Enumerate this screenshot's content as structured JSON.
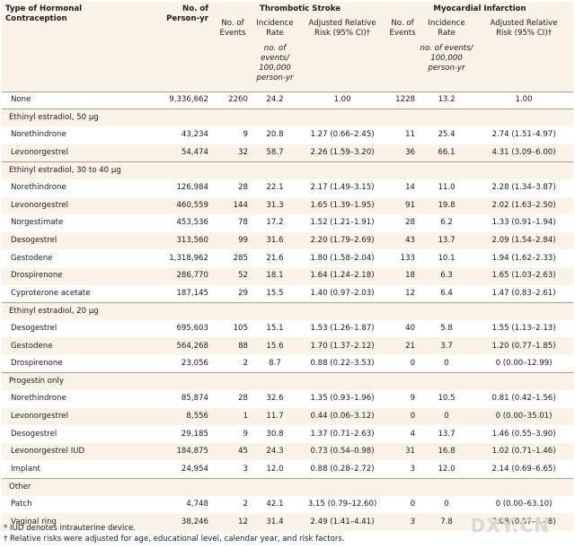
{
  "headers": {
    "type": "Type of Hormonal Contraception",
    "person_yr_1": "No. of",
    "person_yr_2": "Person-yr",
    "stroke": "Thrombotic Stroke",
    "mi": "Myocardial Infarction",
    "events_1": "No. of",
    "events_2": "Events",
    "rate_1": "Incidence",
    "rate_2": "Rate",
    "rr_1": "Adjusted Relative",
    "rr_2": "Risk (95% CI)†",
    "rate_unit_1": "no. of events/",
    "rate_unit_2": "100,000",
    "rate_unit_3": "person-yr"
  },
  "rows": [
    {
      "kind": "data",
      "label": "None",
      "indent": false,
      "py": "9,336,662",
      "s_ev": "2260",
      "s_rate": "24.2",
      "s_rr": "1.00",
      "m_ev": "1228",
      "m_rate": "13.2",
      "m_rr": "1.00"
    },
    {
      "kind": "group",
      "label": "Ethinyl estradiol, 50 μg"
    },
    {
      "kind": "data",
      "label": "Norethindrone",
      "indent": true,
      "py": "43,234",
      "s_ev": "9",
      "s_rate": "20.8",
      "s_rr": "1.27 (0.66–2.45)",
      "m_ev": "11",
      "m_rate": "25.4",
      "m_rr": "2.74 (1.51–4.97)"
    },
    {
      "kind": "data",
      "label": "Levonorgestrel",
      "indent": true,
      "py": "54,474",
      "s_ev": "32",
      "s_rate": "58.7",
      "s_rr": "2.26 (1.59–3.20)",
      "m_ev": "36",
      "m_rate": "66.1",
      "m_rr": "4.31 (3.09–6.00)"
    },
    {
      "kind": "group",
      "label": "Ethinyl estradiol, 30 to 40 μg"
    },
    {
      "kind": "data",
      "label": "Norethindrone",
      "indent": true,
      "py": "126,984",
      "s_ev": "28",
      "s_rate": "22.1",
      "s_rr": "2.17 (1.49–3.15)",
      "m_ev": "14",
      "m_rate": "11.0",
      "m_rr": "2.28 (1.34–3.87)"
    },
    {
      "kind": "data",
      "label": "Levonorgestrel",
      "indent": true,
      "py": "460,559",
      "s_ev": "144",
      "s_rate": "31.3",
      "s_rr": "1.65 (1.39–1.95)",
      "m_ev": "91",
      "m_rate": "19.8",
      "m_rr": "2.02 (1.63–2.50)"
    },
    {
      "kind": "data",
      "label": "Norgestimate",
      "indent": true,
      "py": "453,536",
      "s_ev": "78",
      "s_rate": "17.2",
      "s_rr": "1.52 (1.21–1.91)",
      "m_ev": "28",
      "m_rate": "6.2",
      "m_rr": "1.33 (0.91–1.94)"
    },
    {
      "kind": "data",
      "label": "Desogestrel",
      "indent": true,
      "py": "313,560",
      "s_ev": "99",
      "s_rate": "31.6",
      "s_rr": "2.20 (1.79–2.69)",
      "m_ev": "43",
      "m_rate": "13.7",
      "m_rr": "2.09 (1.54–2.84)"
    },
    {
      "kind": "data",
      "label": "Gestodene",
      "indent": true,
      "py": "1,318,962",
      "s_ev": "285",
      "s_rate": "21.6",
      "s_rr": "1.80 (1.58–2.04)",
      "m_ev": "133",
      "m_rate": "10.1",
      "m_rr": "1.94 (1.62–2.33)"
    },
    {
      "kind": "data",
      "label": "Drospirenone",
      "indent": true,
      "py": "286,770",
      "s_ev": "52",
      "s_rate": "18.1",
      "s_rr": "1.64 (1.24–2.18)",
      "m_ev": "18",
      "m_rate": "6.3",
      "m_rr": "1.65 (1.03–2.63)"
    },
    {
      "kind": "data",
      "label": "Cyproterone acetate",
      "indent": true,
      "py": "187,145",
      "s_ev": "29",
      "s_rate": "15.5",
      "s_rr": "1.40 (0.97–2.03)",
      "m_ev": "12",
      "m_rate": "6.4",
      "m_rr": "1.47 (0.83–2.61)"
    },
    {
      "kind": "group",
      "label": "Ethinyl estradiol, 20 μg"
    },
    {
      "kind": "data",
      "label": "Desogestrel",
      "indent": true,
      "py": "695,603",
      "s_ev": "105",
      "s_rate": "15.1",
      "s_rr": "1.53 (1.26–1.87)",
      "m_ev": "40",
      "m_rate": "5.8",
      "m_rr": "1.55 (1.13–2.13)"
    },
    {
      "kind": "data",
      "label": "Gestodene",
      "indent": true,
      "py": "564,268",
      "s_ev": "88",
      "s_rate": "15.6",
      "s_rr": "1.70 (1.37–2.12)",
      "m_ev": "21",
      "m_rate": "3.7",
      "m_rr": "1.20 (0.77–1.85)"
    },
    {
      "kind": "data",
      "label": "Drospirenone",
      "indent": true,
      "py": "23,056",
      "s_ev": "2",
      "s_rate": "8.7",
      "s_rr": "0.88 (0.22–3.53)",
      "m_ev": "0",
      "m_rate": "0",
      "m_rr": "0 (0.00–12.99)"
    },
    {
      "kind": "group",
      "label": "Progestin only"
    },
    {
      "kind": "data",
      "label": "Norethindrone",
      "indent": true,
      "py": "85,874",
      "s_ev": "28",
      "s_rate": "32.6",
      "s_rr": "1.35 (0.93–1.96)",
      "m_ev": "9",
      "m_rate": "10.5",
      "m_rr": "0.81 (0.42–1.56)"
    },
    {
      "kind": "data",
      "label": "Levonorgestrel",
      "indent": true,
      "py": "8,556",
      "s_ev": "1",
      "s_rate": "11.7",
      "s_rr": "0.44 (0.06–3.12)",
      "m_ev": "0",
      "m_rate": "0",
      "m_rr": "0 (0.00–35.01)"
    },
    {
      "kind": "data",
      "label": "Desogestrel",
      "indent": true,
      "py": "29,185",
      "s_ev": "9",
      "s_rate": "30.8",
      "s_rr": "1.37 (0.71–2.63)",
      "m_ev": "4",
      "m_rate": "13.7",
      "m_rr": "1.46 (0.55–3.90)"
    },
    {
      "kind": "data",
      "label": "Levonorgestrel IUD",
      "indent": true,
      "py": "184,875",
      "s_ev": "45",
      "s_rate": "24.3",
      "s_rr": "0.73 (0.54–0.98)",
      "m_ev": "31",
      "m_rate": "16.8",
      "m_rr": "1.02 (0.71–1.46)"
    },
    {
      "kind": "data",
      "label": "Implant",
      "indent": true,
      "py": "24,954",
      "s_ev": "3",
      "s_rate": "12.0",
      "s_rr": "0.88 (0.28–2.72)",
      "m_ev": "3",
      "m_rate": "12.0",
      "m_rr": "2.14 (0.69–6.65)"
    },
    {
      "kind": "group",
      "label": "Other"
    },
    {
      "kind": "data",
      "label": "Patch",
      "indent": true,
      "py": "4,748",
      "s_ev": "2",
      "s_rate": "42.1",
      "s_rr": "3.15 (0.79–12.60)",
      "m_ev": "0",
      "m_rate": "0",
      "m_rr": "0 (0.00–63.10)"
    },
    {
      "kind": "data",
      "label": "Vaginal ring",
      "indent": true,
      "py": "38,246",
      "s_ev": "12",
      "s_rate": "31.4",
      "s_rr": "2.49 (1.41–4.41)",
      "m_ev": "3",
      "m_rate": "7.8",
      "m_rr": "2.08 (0.67–6.48)"
    }
  ],
  "footnotes": [
    "* IUD denotes intrauterine device.",
    "† Relative risks were adjusted for age, educational level, calendar year, and risk factors."
  ],
  "watermark": "DXY.CN"
}
